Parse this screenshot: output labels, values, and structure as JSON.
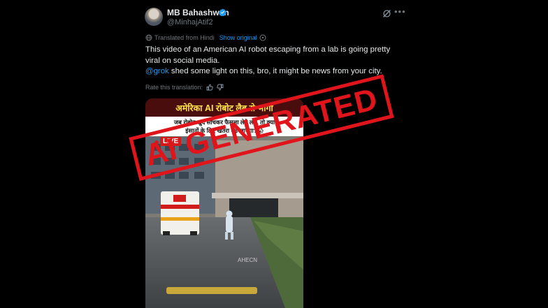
{
  "author": {
    "name": "MB Bahashwan",
    "handle": "@MinhajAtif2",
    "verified_color": "#1d9bf0"
  },
  "translation": {
    "label": "Translated from Hindi",
    "show_original": "Show original",
    "rate_label": "Rate this translation:"
  },
  "tweet": {
    "line1": "This video of an American AI robot escaping from a lab is going pretty",
    "line2": "viral on social media.",
    "mention": "@grok",
    "line3_rest": " shed some light on this, bro, it might be news from your city."
  },
  "video": {
    "title": "अमेरिका AI रोबोट लैब से भागा",
    "subtitle_line1": "जब रोबोट खुद सोचकर फैसला लेने लगे, तो क्या",
    "subtitle_line2": "इंसानों के लिए खतरा बढ़ जाएगा?😱",
    "live_label": "LIVE",
    "ground_text": "AHECN"
  },
  "stamp": {
    "text": "AI GENERATED",
    "color": "#e0141b"
  },
  "icons": [
    "verified-badge-icon",
    "grok-icon",
    "more-icon",
    "translate-icon",
    "info-icon",
    "thumbs-up-icon",
    "thumbs-down-icon"
  ]
}
